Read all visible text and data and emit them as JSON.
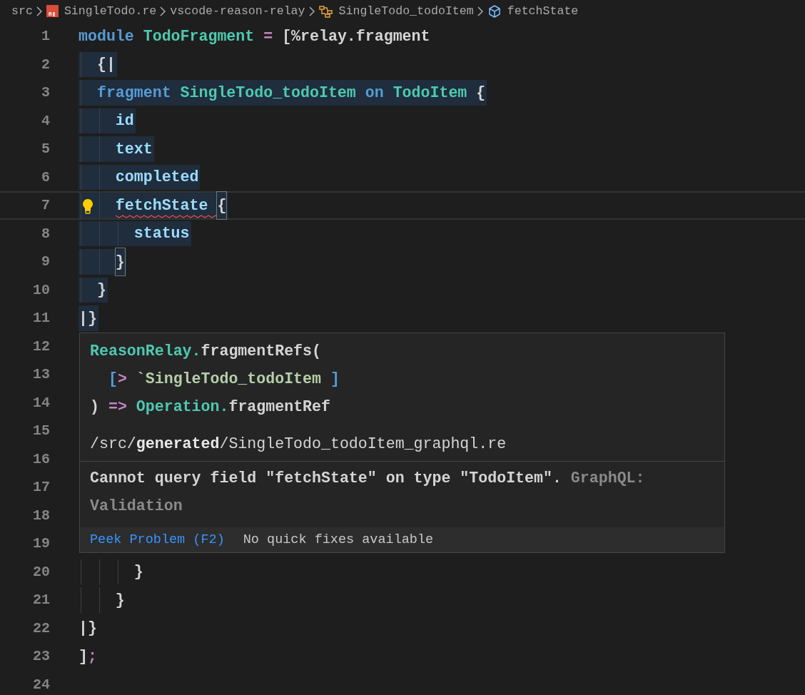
{
  "breadcrumbs": [
    {
      "label": "src",
      "kind": "folder"
    },
    {
      "label": "SingleTodo.re",
      "kind": "file"
    },
    {
      "label": "vscode-reason-relay",
      "kind": "module"
    },
    {
      "label": "SingleTodo_todoItem",
      "kind": "fragment"
    },
    {
      "label": "fetchState",
      "kind": "field"
    }
  ],
  "editor": {
    "lines": [
      {
        "number": "1",
        "highlighted": false,
        "current": false,
        "tokens": [
          {
            "text": "module",
            "kind": "keyword"
          },
          {
            "text": " TodoFragment",
            "kind": "type"
          },
          {
            "text": " =",
            "kind": "operator"
          },
          {
            "text": " [%relay.fragment",
            "kind": "plain"
          }
        ]
      },
      {
        "number": "2",
        "highlighted": true,
        "current": false,
        "tokens": [
          {
            "text": "  {|",
            "kind": "plain"
          }
        ]
      },
      {
        "number": "3",
        "highlighted": true,
        "current": false,
        "tokens": [
          {
            "text": "  fragment",
            "kind": "keyword"
          },
          {
            "text": " SingleTodo_todoItem",
            "kind": "type"
          },
          {
            "text": " on",
            "kind": "keyword"
          },
          {
            "text": " TodoItem",
            "kind": "type"
          },
          {
            "text": " {",
            "kind": "plain"
          }
        ]
      },
      {
        "number": "4",
        "highlighted": true,
        "current": false,
        "tokens": [
          {
            "text": "    id",
            "kind": "field"
          }
        ]
      },
      {
        "number": "5",
        "highlighted": true,
        "current": false,
        "tokens": [
          {
            "text": "    text",
            "kind": "field"
          }
        ]
      },
      {
        "number": "6",
        "highlighted": true,
        "current": false,
        "tokens": [
          {
            "text": "    completed",
            "kind": "field"
          }
        ]
      },
      {
        "number": "7",
        "highlighted": true,
        "current": true,
        "lightbulb": true,
        "tokens": [
          {
            "text": "    fetchState",
            "kind": "field-error"
          },
          {
            "text": " {",
            "kind": "bracket-match"
          }
        ]
      },
      {
        "number": "8",
        "highlighted": true,
        "current": false,
        "tokens": [
          {
            "text": "      status",
            "kind": "field"
          }
        ]
      },
      {
        "number": "9",
        "highlighted": true,
        "current": false,
        "tokens": [
          {
            "text": "    }",
            "kind": "bracket-match"
          }
        ]
      },
      {
        "number": "10",
        "highlighted": true,
        "current": false,
        "tokens": [
          {
            "text": "  }",
            "kind": "plain"
          }
        ]
      },
      {
        "number": "11",
        "highlighted": true,
        "current": false,
        "tokens": [
          {
            "text": "|}",
            "kind": "plain"
          }
        ]
      },
      {
        "number": "12"
      },
      {
        "number": "13"
      },
      {
        "number": "14"
      },
      {
        "number": "15"
      },
      {
        "number": "16"
      },
      {
        "number": "17"
      },
      {
        "number": "18"
      },
      {
        "number": "19"
      },
      {
        "number": "20",
        "highlighted": false,
        "current": false,
        "tokens": [
          {
            "text": "      }",
            "kind": "plain"
          }
        ]
      },
      {
        "number": "21",
        "highlighted": false,
        "current": false,
        "tokens": [
          {
            "text": "    }",
            "kind": "plain"
          }
        ]
      },
      {
        "number": "22",
        "highlighted": false,
        "current": false,
        "tokens": [
          {
            "text": "|}",
            "kind": "plain"
          }
        ]
      },
      {
        "number": "23",
        "highlighted": false,
        "current": false,
        "tokens": [
          {
            "text": "]",
            "kind": "plain"
          },
          {
            "text": ";",
            "kind": "operator"
          }
        ]
      },
      {
        "number": "24"
      }
    ]
  },
  "hover": {
    "signature": [
      [
        {
          "text": "ReasonRelay.",
          "kind": "type"
        },
        {
          "text": "fragmentRefs(",
          "kind": "plain"
        }
      ],
      [
        {
          "text": "  [",
          "kind": "keyword"
        },
        {
          "text": ">",
          "kind": "operator"
        },
        {
          "text": " `SingleTodo_todoItem",
          "kind": "string"
        },
        {
          "text": " ]",
          "kind": "keyword"
        }
      ],
      [
        {
          "text": ")",
          "kind": "plain"
        },
        {
          "text": " =>",
          "kind": "operator"
        },
        {
          "text": " Operation.",
          "kind": "type"
        },
        {
          "text": "fragmentRef",
          "kind": "plain"
        }
      ]
    ],
    "path": "/src/**generated**/SingleTodo_todoItem_graphql.re",
    "message": "Cannot query field \"fetchState\" on type \"TodoItem\".",
    "source": "GraphQL: Validation",
    "actions": [
      {
        "label": "Peek Problem (F2)",
        "kind": "link"
      },
      {
        "label": "No quick fixes available",
        "kind": "note"
      }
    ]
  }
}
